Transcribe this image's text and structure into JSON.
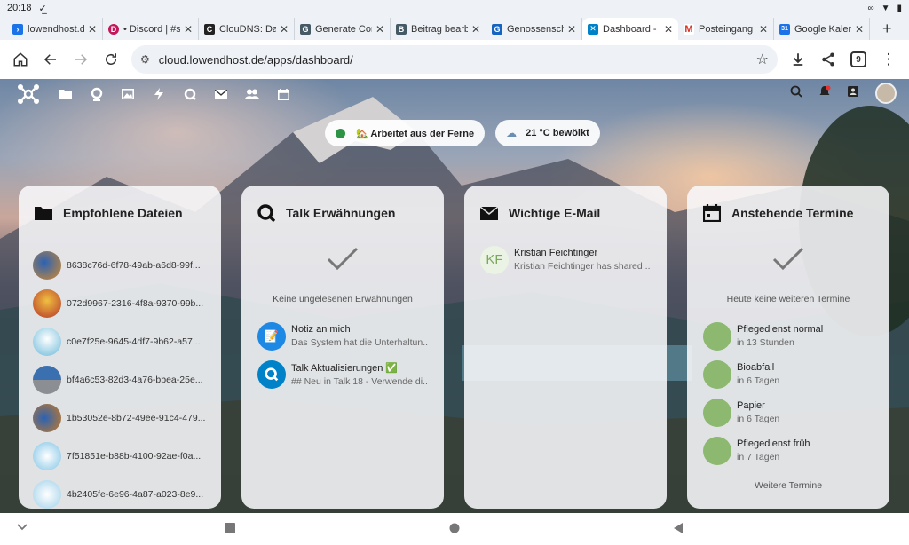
{
  "status": {
    "time": "20:18"
  },
  "tabs": [
    {
      "title": "lowendhost.de",
      "color": "#1a73e8",
      "letter": "›"
    },
    {
      "title": "• Discord | #su",
      "color": "#c2185b",
      "letter": "D"
    },
    {
      "title": "ClouDNS: Dasl",
      "color": "#222222",
      "letter": "C"
    },
    {
      "title": "Generate Conf",
      "color": "#455a64",
      "letter": "G"
    },
    {
      "title": "Beitrag bearbe",
      "color": "#455a64",
      "letter": "B"
    },
    {
      "title": "Genossenscha",
      "color": "#1565c0",
      "letter": "G"
    },
    {
      "title": "Dashboard - D",
      "color": "#0082c9",
      "letter": "✕"
    },
    {
      "title": "Posteingang (",
      "color": "#d93025",
      "letter": "M"
    },
    {
      "title": "Google Kalend",
      "color": "#1a73e8",
      "letter": "31"
    }
  ],
  "browser": {
    "url": "cloud.lowendhost.de/apps/dashboard/",
    "tab_count": "9"
  },
  "statuses": {
    "status_text": "🏡 Arbeitet aus der Ferne",
    "weather_text": "21 °C bewölkt"
  },
  "panels": {
    "files": {
      "title": "Empfohlene Dateien",
      "items": [
        {
          "name": "8638c76d-6f78-49ab-a6d8-99f...",
          "thumb": "#d58a2a"
        },
        {
          "name": "072d9967-2316-4f8a-9370-99b...",
          "thumb": "#b5352a"
        },
        {
          "name": "c0e7f25e-9645-4df7-9b62-a57...",
          "thumb": "#6bb9d9"
        },
        {
          "name": "bf4a6c53-82d3-4a76-bbea-25e...",
          "thumb": "#3a6fb0"
        },
        {
          "name": "1b53052e-8b72-49ee-91c4-479...",
          "thumb": "#c97a22"
        },
        {
          "name": "7f51851e-b88b-4100-92ae-f0a...",
          "thumb": "#7fc3e6"
        },
        {
          "name": "4b2405fe-6e96-4a87-a023-8e9...",
          "thumb": "#9fd0ea"
        }
      ]
    },
    "talk": {
      "title": "Talk Erwähnungen",
      "empty": "Keine ungelesenen Erwähnungen",
      "items": [
        {
          "title": "Notiz an mich",
          "sub": "Das System hat die Unterhaltun..."
        },
        {
          "title": "Talk Aktualisierungen ✅",
          "sub": "## Neu in Talk 18 - Verwende di..."
        }
      ]
    },
    "mail": {
      "title": "Wichtige E-Mail",
      "items": [
        {
          "initials": "KF",
          "title": "Kristian Feichtinger",
          "sub": "Kristian Feichtinger has shared ..."
        }
      ]
    },
    "calendar": {
      "title": "Anstehende Termine",
      "empty": "Heute keine weiteren Termine",
      "items": [
        {
          "title": "Pflegedienst normal",
          "sub": "in 13 Stunden"
        },
        {
          "title": "Bioabfall",
          "sub": "in 6 Tagen"
        },
        {
          "title": "Papier",
          "sub": "in 6 Tagen"
        },
        {
          "title": "Pflegedienst früh",
          "sub": "in 7 Tagen"
        }
      ],
      "more": "Weitere Termine"
    }
  },
  "colors": {
    "event": "#8cb870",
    "status_online": "#2d9445",
    "nc_blue": "#0082c9"
  }
}
